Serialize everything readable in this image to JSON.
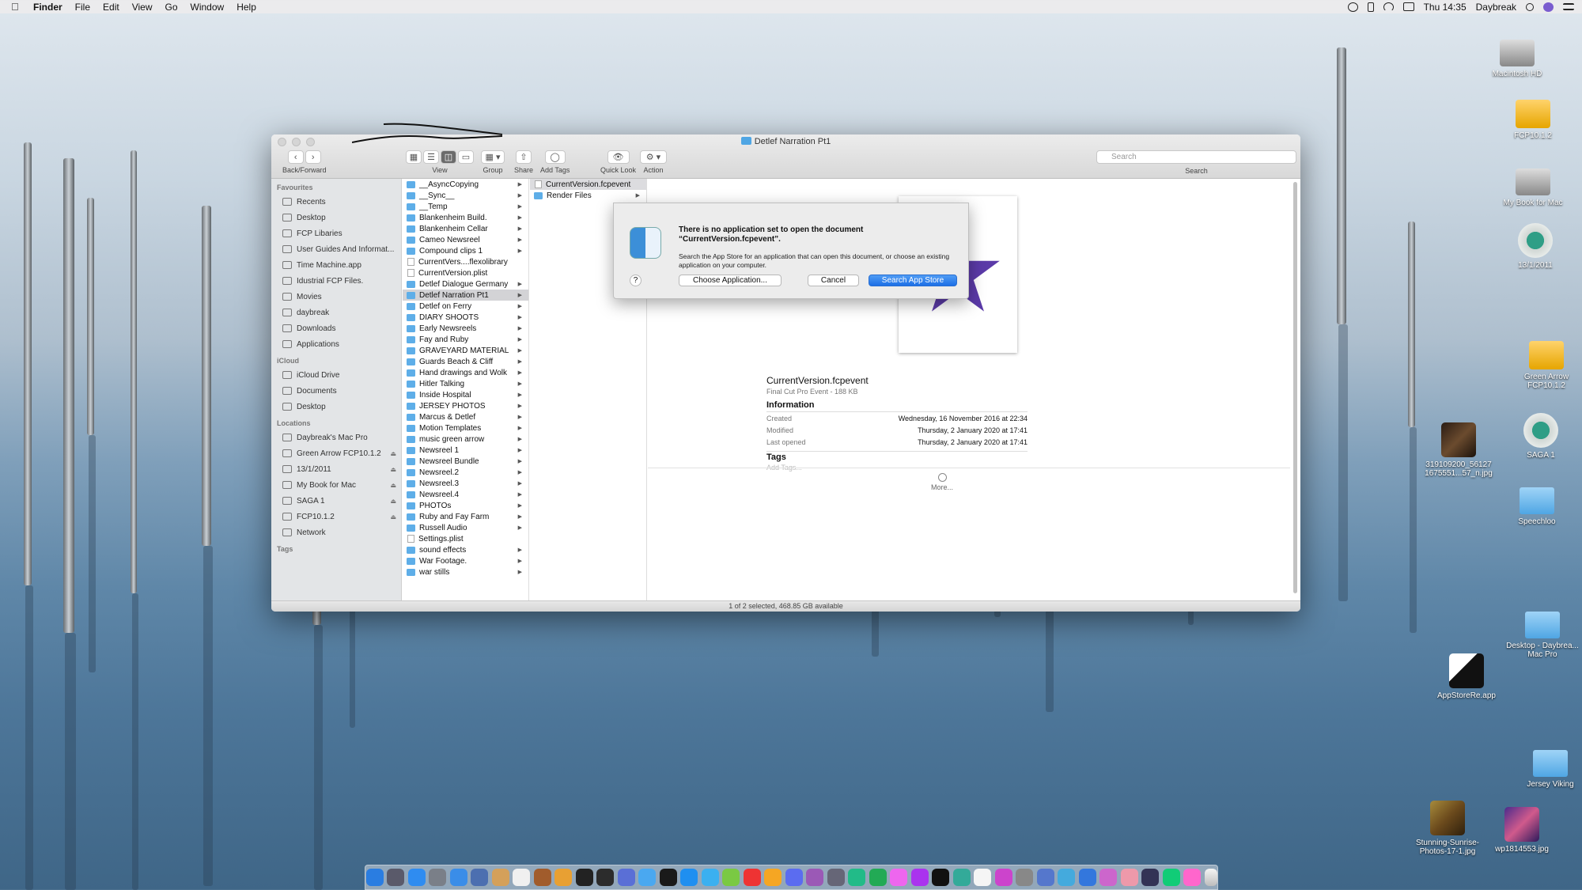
{
  "menubar": {
    "apple": "",
    "app_name": "Finder",
    "items": [
      "File",
      "Edit",
      "View",
      "Go",
      "Window",
      "Help"
    ],
    "clock": "Thu 14:35",
    "user": "Daybreak"
  },
  "desktop_icons": [
    {
      "label": "Macintosh HD",
      "type": "drive"
    },
    {
      "label": "FCP10.1.2",
      "type": "ydrive"
    },
    {
      "label": "My Book for Mac",
      "type": "drive"
    },
    {
      "label": "13/1/2011",
      "type": "tm"
    },
    {
      "label": "Green Arrow FCP10.1.2",
      "type": "ydrive"
    },
    {
      "label": "SAGA 1",
      "type": "tm"
    },
    {
      "label": "319109200_56127 1675551...57_n.jpg",
      "type": "pic"
    },
    {
      "label": "Speechloo",
      "type": "folder"
    },
    {
      "label": "Desktop - Daybrea... Mac Pro",
      "type": "folder"
    },
    {
      "label": "AppStoreRe.app",
      "type": "app"
    },
    {
      "label": "Jersey Viking",
      "type": "folder"
    },
    {
      "label": "Stunning-Sunrise-Photos-17-1.jpg",
      "type": "pic2"
    },
    {
      "label": "wp1814553.jpg",
      "type": "pic3"
    }
  ],
  "window": {
    "title": "Detlef Narration Pt1",
    "toolbar": {
      "back_forward": "Back/Forward",
      "view": "View",
      "group": "Group",
      "share": "Share",
      "add_tags": "Add Tags",
      "quick_look": "Quick Look",
      "action": "Action",
      "search_label": "Search",
      "search_placeholder": "Search"
    },
    "sidebar": {
      "favourites_heading": "Favourites",
      "favourites": [
        "Recents",
        "Desktop",
        "FCP Libaries",
        "User Guides And Informat...",
        "Time Machine.app",
        "Idustrial FCP Files.",
        "Movies",
        "daybreak",
        "Downloads",
        "Applications"
      ],
      "icloud_heading": "iCloud",
      "icloud": [
        "iCloud Drive",
        "Documents",
        "Desktop"
      ],
      "locations_heading": "Locations",
      "locations": [
        "Daybreak's Mac Pro",
        "Green Arrow FCP10.1.2",
        "13/1/2011",
        "My Book for Mac",
        "SAGA 1",
        "FCP10.1.2",
        "Network"
      ],
      "tags_heading": "Tags"
    },
    "column1": [
      {
        "name": "__AsyncCopying",
        "kind": "folder"
      },
      {
        "name": "__Sync__",
        "kind": "folder"
      },
      {
        "name": "__Temp",
        "kind": "folder"
      },
      {
        "name": "Blankenheim Build.",
        "kind": "folder"
      },
      {
        "name": "Blankenheim Cellar",
        "kind": "folder"
      },
      {
        "name": "Cameo Newsreel",
        "kind": "folder"
      },
      {
        "name": "Compound clips 1",
        "kind": "folder"
      },
      {
        "name": "CurrentVers....flexolibrary",
        "kind": "doc"
      },
      {
        "name": "CurrentVersion.plist",
        "kind": "doc"
      },
      {
        "name": "Detlef Dialogue Germany",
        "kind": "folder"
      },
      {
        "name": "Detlef Narration Pt1",
        "kind": "folder",
        "selected": true
      },
      {
        "name": "Detlef on Ferry",
        "kind": "folder"
      },
      {
        "name": "DIARY SHOOTS",
        "kind": "folder"
      },
      {
        "name": "Early Newsreels",
        "kind": "folder"
      },
      {
        "name": "Fay and Ruby",
        "kind": "folder"
      },
      {
        "name": "GRAVEYARD MATERIAL",
        "kind": "folder"
      },
      {
        "name": "Guards Beach & Cliff",
        "kind": "folder"
      },
      {
        "name": "Hand drawings and Wolk",
        "kind": "folder"
      },
      {
        "name": "Hitler Talking",
        "kind": "folder"
      },
      {
        "name": "Inside Hospital",
        "kind": "folder"
      },
      {
        "name": "JERSEY PHOTOS",
        "kind": "folder"
      },
      {
        "name": "Marcus & Detlef",
        "kind": "folder"
      },
      {
        "name": "Motion Templates",
        "kind": "folder"
      },
      {
        "name": "music green arrow",
        "kind": "folder"
      },
      {
        "name": "Newsreel 1",
        "kind": "folder"
      },
      {
        "name": "Newsreel Bundle",
        "kind": "folder"
      },
      {
        "name": "Newsreel.2",
        "kind": "folder"
      },
      {
        "name": "Newsreel.3",
        "kind": "folder"
      },
      {
        "name": "Newsreel.4",
        "kind": "folder"
      },
      {
        "name": "PHOTOs",
        "kind": "folder"
      },
      {
        "name": "Ruby and Fay Farm",
        "kind": "folder"
      },
      {
        "name": "Russell Audio",
        "kind": "folder"
      },
      {
        "name": "Settings.plist",
        "kind": "doc"
      },
      {
        "name": "sound effects",
        "kind": "folder"
      },
      {
        "name": "War Footage.",
        "kind": "folder"
      },
      {
        "name": "war stills",
        "kind": "folder"
      }
    ],
    "column2": [
      {
        "name": "CurrentVersion.fcpevent",
        "kind": "doc",
        "selected": true
      },
      {
        "name": "Render Files",
        "kind": "folder"
      }
    ],
    "preview": {
      "file_name": "CurrentVersion.fcpevent",
      "file_kind": "Final Cut Pro Event - 188 KB",
      "info_heading": "Information",
      "created_label": "Created",
      "created_value": "Wednesday, 16 November 2016 at 22:34",
      "modified_label": "Modified",
      "modified_value": "Thursday, 2 January 2020 at 17:41",
      "opened_label": "Last opened",
      "opened_value": "Thursday, 2 January 2020 at 17:41",
      "tags_heading": "Tags",
      "tags_placeholder": "Add Tags...",
      "more_label": "More...",
      "star_color": "#5b3aa8"
    },
    "status": "1 of 2 selected, 468.85 GB available"
  },
  "dialog": {
    "title_line1": "There is no application set to open the document",
    "title_line2": "“CurrentVersion.fcpevent”.",
    "body": "Search the App Store for an application that can open this document, or choose an existing application on your computer.",
    "help": "?",
    "choose_app": "Choose Application...",
    "cancel": "Cancel",
    "search_store": "Search App Store"
  },
  "dock": {
    "colors": [
      "#2a7de1",
      "#5a5a6a",
      "#2f8cf0",
      "#7a7f88",
      "#3a8de8",
      "#4c6fb0",
      "#d4a05a",
      "#f0f0f0",
      "#a15c2c",
      "#e8a033",
      "#222",
      "#2c2c2c",
      "#5a6fd6",
      "#4aa8f0",
      "#1a1a1a",
      "#1f8ff0",
      "#3bb0f0",
      "#7ac943",
      "#e33",
      "#f5a623",
      "#5b6cf0",
      "#9b59b6",
      "#667",
      "#2b8",
      "#2a5",
      "#e6e",
      "#a3e",
      "#111",
      "#3a9",
      "#f5f5f5",
      "#c4c",
      "#888",
      "#57c",
      "#4ad",
      "#37d",
      "#c6c",
      "#e9a",
      "#335",
      "#1c7",
      "#f6c"
    ],
    "trash": "trash-icon"
  }
}
